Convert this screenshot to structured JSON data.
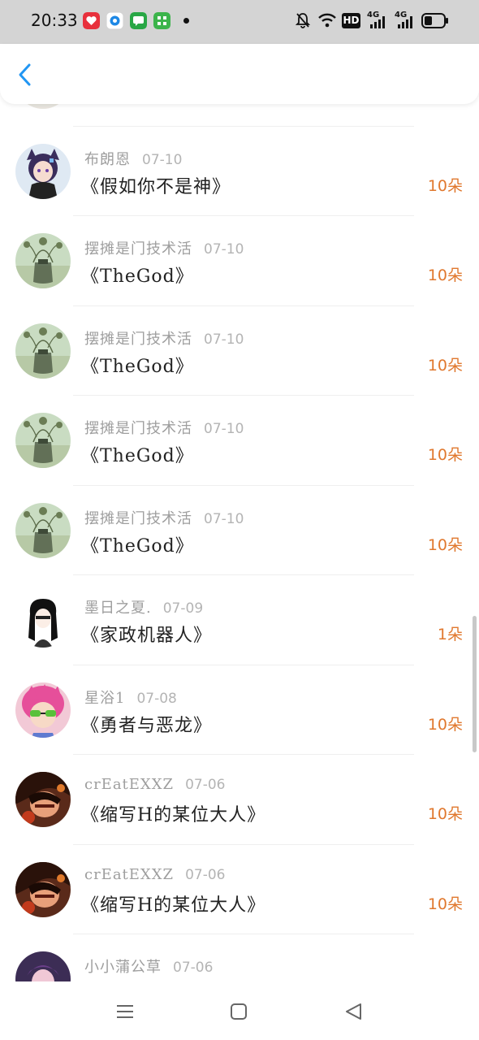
{
  "status_bar": {
    "time": "20:33",
    "icons": [
      "app-icon-heart",
      "app-icon-target",
      "app-icon-chat",
      "app-icon-grid",
      "dot",
      "bell-off-icon",
      "wifi-icon",
      "hd-icon",
      "signal-4g-icon",
      "signal-4g-icon",
      "battery-icon"
    ],
    "hd_label": "HD",
    "network_label": "4G"
  },
  "header": {
    "back_icon": "chevron-left-icon",
    "accent": "#2196f3"
  },
  "rows": [
    {
      "name": "",
      "date": "",
      "title": "《·············》",
      "count": "",
      "avatar": "hidden"
    },
    {
      "name": "布朗恩",
      "date": "07-10",
      "title": "《假如你不是神》",
      "count": "10朵",
      "avatar": "anime-cat-girl"
    },
    {
      "name": "摆摊是门技术活",
      "date": "07-10",
      "title": "《TheGod》",
      "count": "10朵",
      "avatar": "plant-vase"
    },
    {
      "name": "摆摊是门技术活",
      "date": "07-10",
      "title": "《TheGod》",
      "count": "10朵",
      "avatar": "plant-vase"
    },
    {
      "name": "摆摊是门技术活",
      "date": "07-10",
      "title": "《TheGod》",
      "count": "10朵",
      "avatar": "plant-vase"
    },
    {
      "name": "摆摊是门技术活",
      "date": "07-10",
      "title": "《TheGod》",
      "count": "10朵",
      "avatar": "plant-vase"
    },
    {
      "name": "墨日之夏.",
      "date": "07-09",
      "title": "《家政机器人》",
      "count": "1朵",
      "avatar": "sketch-girl"
    },
    {
      "name": "星浴1",
      "date": "07-08",
      "title": "《勇者与恶龙》",
      "count": "10朵",
      "avatar": "pink-hair-anime"
    },
    {
      "name": "crEatEXXZ",
      "date": "07-06",
      "title": "《缩写H的某位大人》",
      "count": "10朵",
      "avatar": "dark-anime"
    },
    {
      "name": "crEatEXXZ",
      "date": "07-06",
      "title": "《缩写H的某位大人》",
      "count": "10朵",
      "avatar": "dark-anime"
    },
    {
      "name": "小小蒲公草",
      "date": "07-06",
      "title": "",
      "count": "",
      "avatar": "purple-portrait"
    }
  ],
  "colors": {
    "count": "#e0782e",
    "name": "#9e9e9e",
    "date": "#b4b4b4",
    "title": "#222222",
    "status_bar_bg": "#d4d4d4"
  },
  "nav_bar": {
    "icons": [
      "menu-icon",
      "home-square-icon",
      "back-triangle-icon"
    ]
  }
}
